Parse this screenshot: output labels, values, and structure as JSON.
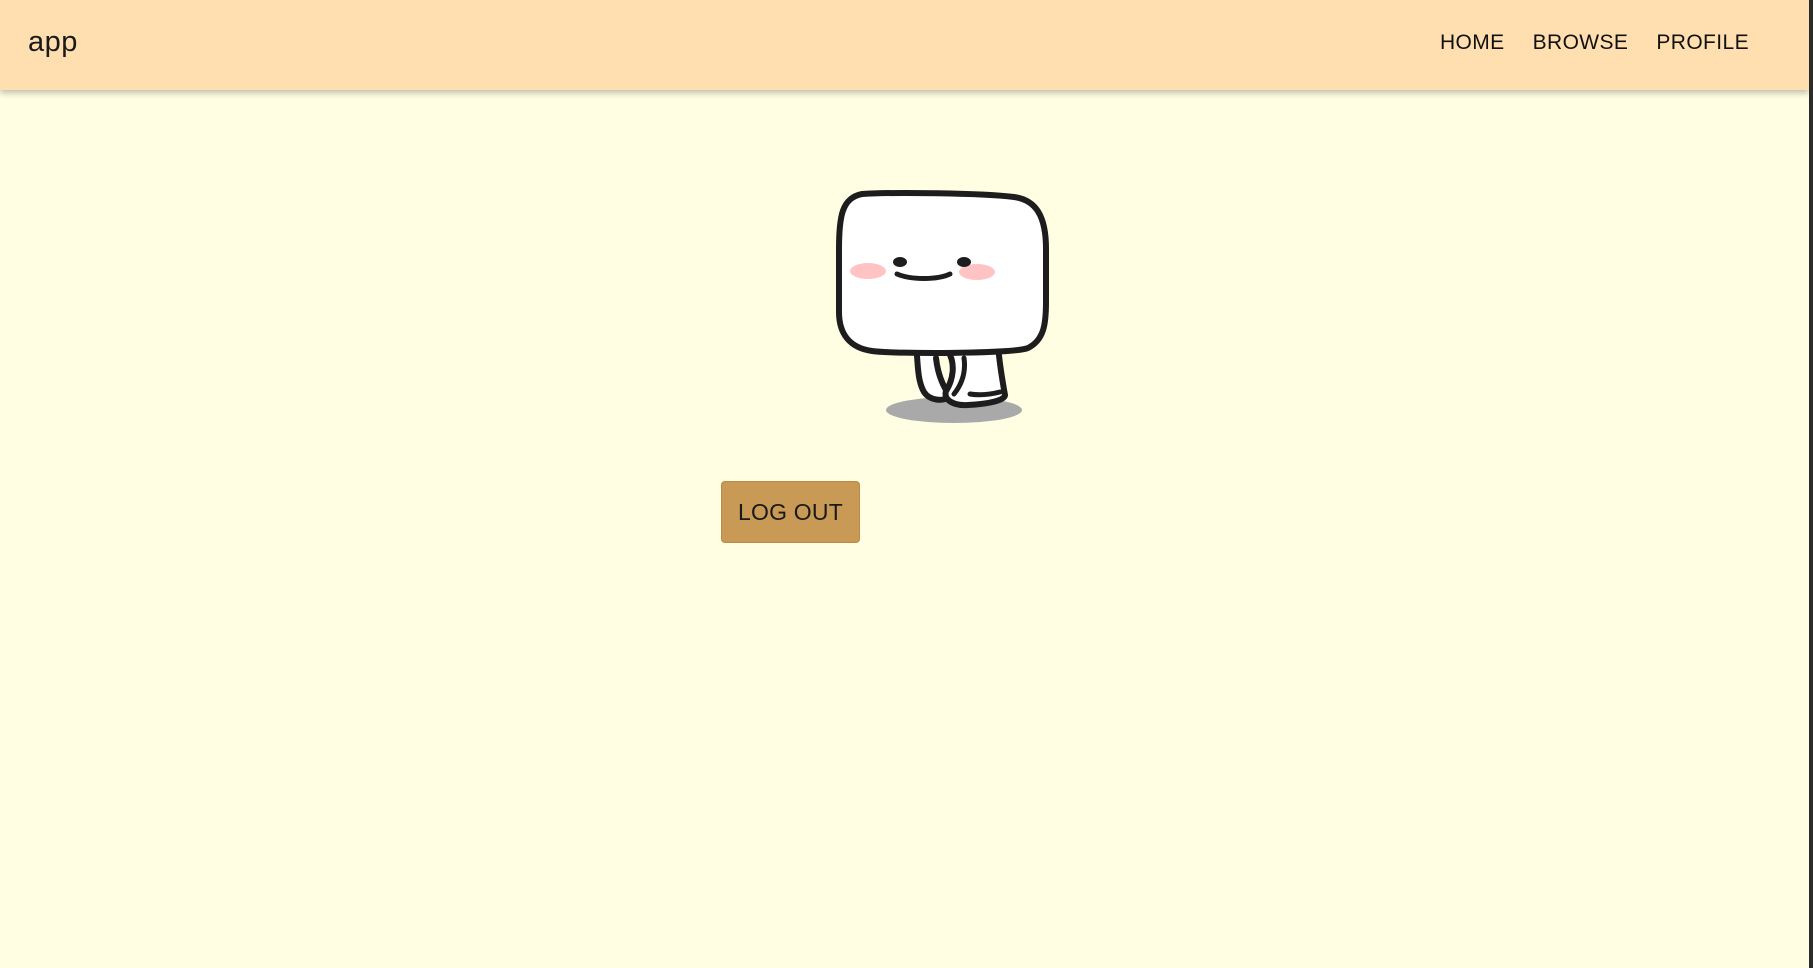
{
  "app": {
    "title": "app"
  },
  "nav": {
    "links": [
      "HOME",
      "BROWSE",
      "PROFILE"
    ]
  },
  "profile": {
    "logout_label": "LOG OUT",
    "mascot_icon": "mascot-icon"
  },
  "colors": {
    "navbar_bg": "#ffdfb0",
    "page_bg": "#fffee3",
    "logout_button_bg": "#c89a55"
  }
}
